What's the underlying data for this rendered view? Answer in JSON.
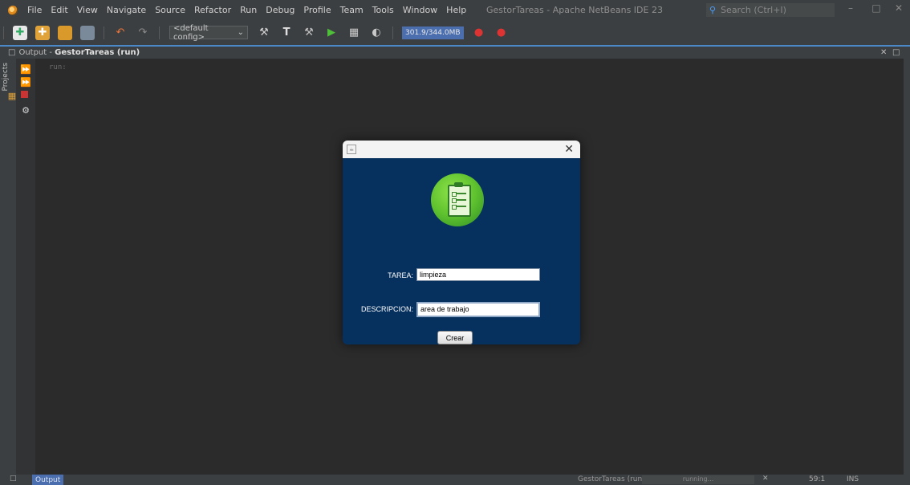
{
  "menu": {
    "items": [
      "File",
      "Edit",
      "View",
      "Navigate",
      "Source",
      "Refactor",
      "Run",
      "Debug",
      "Profile",
      "Team",
      "Tools",
      "Window",
      "Help"
    ]
  },
  "window": {
    "title": "GestorTareas - Apache NetBeans IDE 23",
    "search_placeholder": "Search (Ctrl+I)"
  },
  "toolbar": {
    "config_select": "<default config>",
    "memory": "301.9/344.0MB"
  },
  "output_panel": {
    "prefix": "Output - ",
    "title": "GestorTareas (run)",
    "console_text": "run:",
    "projects_label": "Projects"
  },
  "dialog": {
    "tarea_label": "TAREA:",
    "tarea_value": "limpieza",
    "descripcion_label": "DESCRIPCION:",
    "descripcion_value": "area de trabajo",
    "button_label": "Crear"
  },
  "statusbar": {
    "output_tab": "Output",
    "run_label": "GestorTareas (run)",
    "progress_text": "running...",
    "position": "59:1",
    "mode": "INS"
  },
  "colors": {
    "dialog_background": "#06305e",
    "logo_green": "#5fc22e",
    "ide_background": "#2b2b2b",
    "accent": "#4a88c7"
  }
}
